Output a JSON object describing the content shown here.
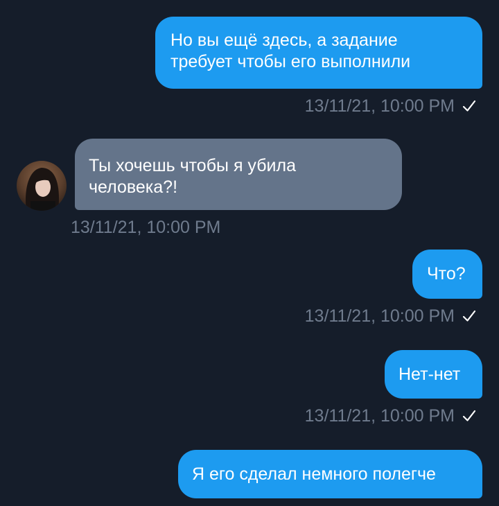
{
  "messages": [
    {
      "direction": "outgoing",
      "text": "Но вы ещё здесь, а задание\nтребует чтобы его выполнили",
      "timestamp": "13/11/21, 10:00 PM",
      "status": "sent"
    },
    {
      "direction": "incoming",
      "text": "Ты хочешь чтобы я убила\nчеловека?!",
      "timestamp": "13/11/21, 10:00 PM"
    },
    {
      "direction": "outgoing",
      "text": "Что?",
      "timestamp": "13/11/21, 10:00 PM",
      "status": "sent"
    },
    {
      "direction": "outgoing",
      "text": "Нет-нет",
      "timestamp": "13/11/21, 10:00 PM",
      "status": "sent"
    },
    {
      "direction": "outgoing",
      "text": "Я его сделал немного полегче"
    }
  ],
  "colors": {
    "background": "#151d2a",
    "outgoing_bubble": "#1d9bf0",
    "incoming_bubble": "#64748a",
    "timestamp": "#6f7b8d"
  },
  "icons": {
    "status_sent": "checkmark-icon",
    "sender_avatar": "avatar"
  }
}
